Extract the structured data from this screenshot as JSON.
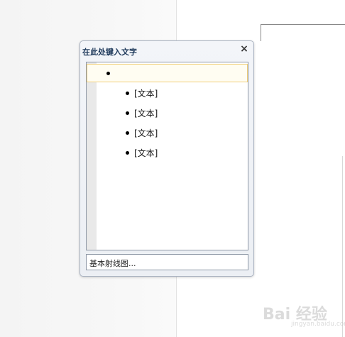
{
  "text_pane": {
    "title": "在此处键入文字",
    "close_glyph": "×",
    "items": [
      {
        "level": 1,
        "text": ""
      },
      {
        "level": 2,
        "text": "[文本]"
      },
      {
        "level": 2,
        "text": "[文本]"
      },
      {
        "level": 2,
        "text": "[文本]"
      },
      {
        "level": 2,
        "text": "[文本]"
      }
    ],
    "layout_description": "基本射线图..."
  },
  "watermark": {
    "main": "Bai 经验",
    "sub": "jingyan.baidu.com"
  },
  "colors": {
    "pane_title": "#1e395b",
    "selection_border": "#f1cf7a"
  }
}
